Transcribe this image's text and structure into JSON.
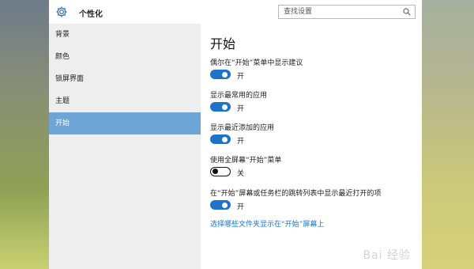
{
  "window": {
    "title": "个性化",
    "search_placeholder": "查找设置"
  },
  "sidebar": {
    "items": [
      {
        "label": "背景",
        "selected": false
      },
      {
        "label": "颜色",
        "selected": false
      },
      {
        "label": "锁屏界面",
        "selected": false
      },
      {
        "label": "主题",
        "selected": false
      },
      {
        "label": "开始",
        "selected": true
      }
    ]
  },
  "main": {
    "title": "开始",
    "settings": [
      {
        "label": "偶尔在“开始”菜单中显示建议",
        "state": "开",
        "on": true
      },
      {
        "label": "显示最常用的应用",
        "state": "开",
        "on": true
      },
      {
        "label": "显示最近添加的应用",
        "state": "开",
        "on": true
      },
      {
        "label": "使用全屏幕“开始”菜单",
        "state": "关",
        "on": false
      },
      {
        "label": "在“开始”屏幕或任务栏的跳转列表中显示最近打开的项",
        "state": "开",
        "on": true
      }
    ],
    "link_text": "选择哪些文件夹显示在“开始”屏幕上"
  },
  "watermark": "Bai 经验",
  "colors": {
    "accent": "#1e73c8",
    "selected_nav": "#6ea4d6",
    "sidebar_bg": "#eeeeee"
  },
  "icons": {
    "settings": "gear-icon",
    "search": "search-icon"
  }
}
